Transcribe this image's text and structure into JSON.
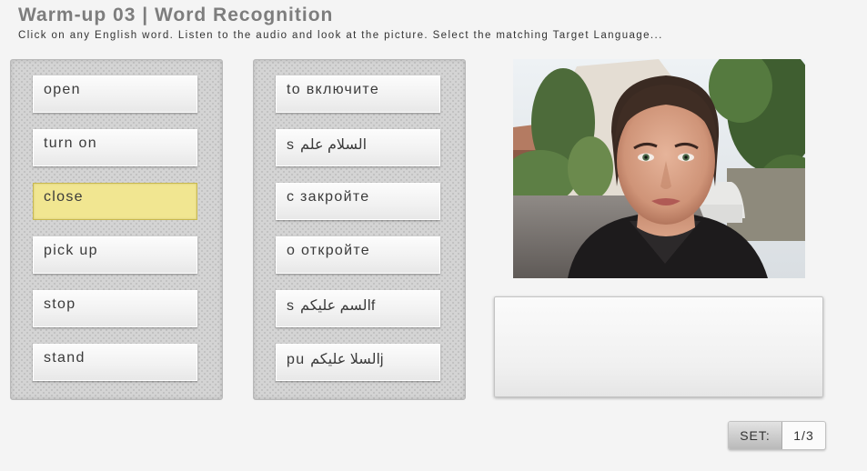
{
  "header": {
    "title": "Warm-up 03 | Word Recognition",
    "instructions": "Click on any English word. Listen to the audio and look at the picture. Select the matching Target Language..."
  },
  "english_words": [
    {
      "label": "open",
      "selected": false
    },
    {
      "label": "turn on",
      "selected": false
    },
    {
      "label": "close",
      "selected": true
    },
    {
      "label": "pick up",
      "selected": false
    },
    {
      "label": "stop",
      "selected": false
    },
    {
      "label": "stand",
      "selected": false
    }
  ],
  "target_words": [
    {
      "label": "to включите"
    },
    {
      "label": "s السلام علم"
    },
    {
      "label": "с закройте"
    },
    {
      "label": "о откройте"
    },
    {
      "label": "s السم عليكمf"
    },
    {
      "label": "pu السلا عليكمj"
    }
  ],
  "picture": {
    "icon": "woman-avatar-photo"
  },
  "answer_box": {
    "text": ""
  },
  "set": {
    "label": "SET:",
    "value": "1/3"
  },
  "colors": {
    "title": "#7d7d7d",
    "selected_word": "#f1e691",
    "background": "#f4f4f4"
  }
}
